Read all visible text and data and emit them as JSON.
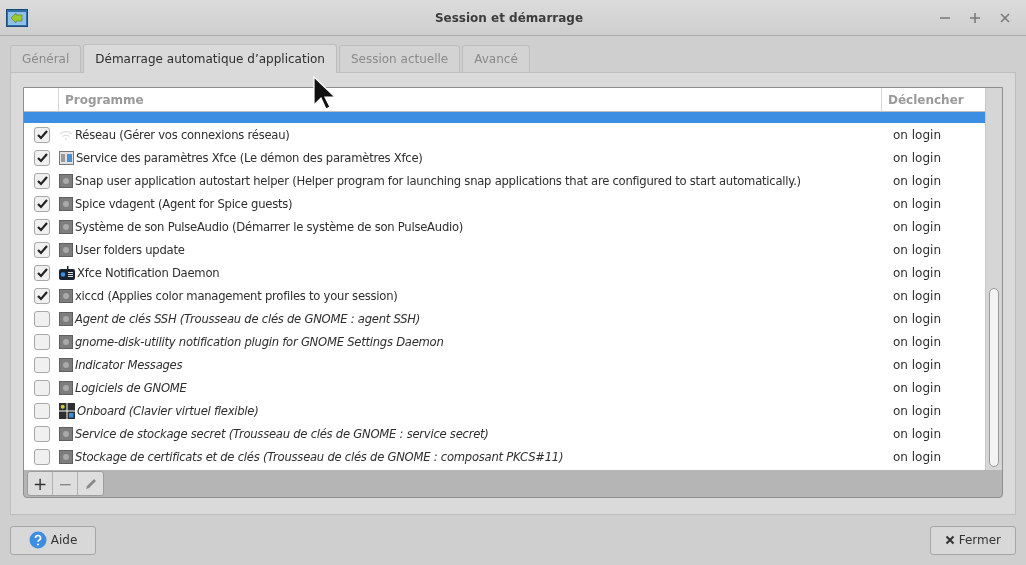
{
  "window": {
    "title": "Session et démarrage"
  },
  "tabs": [
    {
      "label": "Général",
      "selected": false
    },
    {
      "label": "Démarrage automatique d’application",
      "selected": true
    },
    {
      "label": "Session actuelle",
      "selected": false
    },
    {
      "label": "Avancé",
      "selected": false
    }
  ],
  "table": {
    "columns": [
      "Programme",
      "Déclencher"
    ],
    "rows": [
      {
        "selected": true
      },
      {
        "kind": "wifi",
        "name": "Réseau (Gérer vos connexions réseau)",
        "trigger": "on login",
        "checked": true,
        "selected": false
      },
      {
        "kind": "panel",
        "name": "Service des paramètres Xfce (Le démon des paramètres Xfce)",
        "trigger": "on login",
        "checked": true,
        "selected": false
      },
      {
        "kind": "gear",
        "name": "Snap user application autostart helper (Helper program for launching snap applications that are configured to start automatically.)",
        "trigger": "on login",
        "checked": true,
        "selected": false
      },
      {
        "kind": "gear",
        "name": "Spice vdagent (Agent for Spice guests)",
        "trigger": "on login",
        "checked": true,
        "selected": false
      },
      {
        "kind": "gear",
        "name": "Système de son PulseAudio (Démarrer le système de son PulseAudio)",
        "trigger": "on login",
        "checked": true,
        "selected": false
      },
      {
        "kind": "gear",
        "name": "User folders update",
        "trigger": "on login",
        "checked": true,
        "selected": false
      },
      {
        "kind": "notification",
        "name": "Xfce Notification Daemon",
        "trigger": "on login",
        "checked": true,
        "selected": false
      },
      {
        "kind": "gear",
        "name": "xiccd (Applies color management profiles to your session)",
        "trigger": "on login",
        "checked": true,
        "selected": false
      },
      {
        "kind": "gear",
        "name": "Agent de clés SSH (Trousseau de clés de GNOME : agent SSH)",
        "trigger": "on login",
        "checked": false,
        "selected": false
      },
      {
        "kind": "gear",
        "name": "gnome-disk-utility notification plugin for GNOME Settings Daemon",
        "trigger": "on login",
        "checked": false,
        "selected": false
      },
      {
        "kind": "gear",
        "name": "Indicator Messages",
        "trigger": "on login",
        "checked": false,
        "selected": false
      },
      {
        "kind": "gear",
        "name": "Logiciels de GNOME",
        "trigger": "on login",
        "checked": false,
        "selected": false
      },
      {
        "kind": "keyboard",
        "name": "Onboard (Clavier virtuel flexible)",
        "trigger": "on login",
        "checked": false,
        "selected": false
      },
      {
        "kind": "gear",
        "name": "Service de stockage secret (Trousseau de clés de GNOME : service secret)",
        "trigger": "on login",
        "checked": false,
        "selected": false
      },
      {
        "kind": "gear",
        "name": "Stockage de certificats et de clés (Trousseau de clés de GNOME : composant PKCS#11)",
        "trigger": "on login",
        "checked": false,
        "selected": false
      }
    ]
  },
  "toolbar": [
    {
      "kind": "add",
      "label": "+"
    },
    {
      "kind": "remove",
      "label": "−"
    },
    {
      "kind": "edit"
    }
  ],
  "buttons": [
    {
      "kind": "help",
      "label": "Aide"
    },
    {
      "kind": "close",
      "label": "Fermer"
    }
  ]
}
